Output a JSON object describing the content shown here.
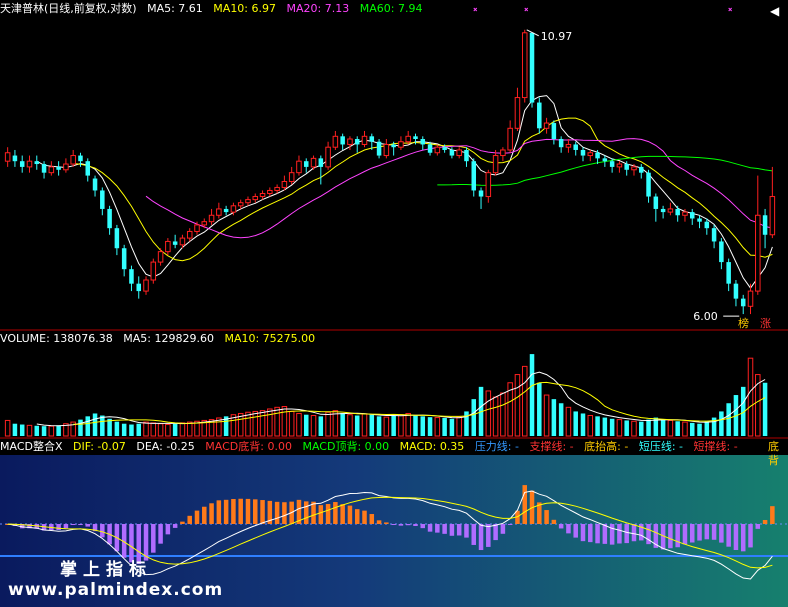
{
  "title": "天津普林(日线,前复权,对数)",
  "price_header": [
    {
      "label": "MA5: 7.61",
      "color": "#ffffff"
    },
    {
      "label": "MA10: 6.97",
      "color": "#ffff00"
    },
    {
      "label": "MA20: 7.13",
      "color": "#ff44ff"
    },
    {
      "label": "MA60: 7.94",
      "color": "#00ff00"
    }
  ],
  "volume_header": [
    {
      "label": "VOLUME: 138076.38",
      "color": "#ffffff"
    },
    {
      "label": "MA5: 129829.60",
      "color": "#ffffff"
    },
    {
      "label": "MA10: 75275.00",
      "color": "#ffff00"
    }
  ],
  "macd_header": [
    {
      "label": "MACD整合X",
      "color": "#ffffff"
    },
    {
      "label": "DIF: -0.07",
      "color": "#ffff00"
    },
    {
      "label": "DEA: -0.25",
      "color": "#ffffff"
    },
    {
      "label": "MACD底背: 0.00",
      "color": "#ff3333"
    },
    {
      "label": "MACD顶背: 0.00",
      "color": "#00ff00"
    },
    {
      "label": "MACD: 0.35",
      "color": "#ffff00"
    },
    {
      "label": "压力线: -",
      "color": "#3399ff"
    },
    {
      "label": "支撑线: -",
      "color": "#ff3333"
    },
    {
      "label": "底抬高: -",
      "color": "#ffcc00"
    },
    {
      "label": "短压线: -",
      "color": "#33ffff"
    },
    {
      "label": "短撑线: -",
      "color": "#ff3333"
    }
  ],
  "macd_right_label": "底背",
  "badges": {
    "bang": "榜",
    "zhang": "涨"
  },
  "watermark": {
    "line1": "掌上指标",
    "line2": "www.palmindex.com"
  },
  "colors": {
    "up": "#ff2020",
    "down": "#33ffff",
    "ma5": "#ffffff",
    "ma10": "#ffff00",
    "ma20": "#ff44ff",
    "ma60": "#00ff00",
    "divider": "#b00000"
  },
  "chart_data": {
    "type": "candlestick",
    "scale": "log",
    "ylim": [
      5.9,
      11.2
    ],
    "annotations": {
      "high": "10.97",
      "low": "6.00"
    },
    "candles": [
      [
        8.3,
        8.45,
        8.55,
        8.2
      ],
      [
        8.4,
        8.3,
        8.5,
        8.2
      ],
      [
        8.3,
        8.2,
        8.4,
        8.1
      ],
      [
        8.2,
        8.3,
        8.4,
        8.1
      ],
      [
        8.3,
        8.25,
        8.4,
        8.15
      ],
      [
        8.25,
        8.1,
        8.3,
        8.0
      ],
      [
        8.1,
        8.2,
        8.3,
        8.05
      ],
      [
        8.2,
        8.15,
        8.3,
        8.05
      ],
      [
        8.15,
        8.25,
        8.35,
        8.1
      ],
      [
        8.25,
        8.4,
        8.5,
        8.2
      ],
      [
        8.4,
        8.3,
        8.45,
        8.2
      ],
      [
        8.3,
        8.05,
        8.35,
        7.95
      ],
      [
        8.0,
        7.8,
        8.05,
        7.7
      ],
      [
        7.8,
        7.5,
        7.85,
        7.4
      ],
      [
        7.5,
        7.2,
        7.55,
        7.1
      ],
      [
        7.2,
        6.9,
        7.25,
        6.8
      ],
      [
        6.9,
        6.6,
        6.95,
        6.5
      ],
      [
        6.6,
        6.4,
        6.65,
        6.3
      ],
      [
        6.4,
        6.3,
        6.5,
        6.2
      ],
      [
        6.3,
        6.45,
        6.5,
        6.25
      ],
      [
        6.45,
        6.7,
        6.75,
        6.4
      ],
      [
        6.7,
        6.85,
        6.9,
        6.65
      ],
      [
        6.85,
        7.0,
        7.05,
        6.8
      ],
      [
        7.0,
        6.95,
        7.1,
        6.9
      ],
      [
        6.95,
        7.05,
        7.1,
        6.9
      ],
      [
        7.05,
        7.15,
        7.2,
        7.0
      ],
      [
        7.15,
        7.25,
        7.3,
        7.1
      ],
      [
        7.25,
        7.3,
        7.35,
        7.2
      ],
      [
        7.3,
        7.4,
        7.5,
        7.25
      ],
      [
        7.4,
        7.5,
        7.6,
        7.35
      ],
      [
        7.5,
        7.45,
        7.55,
        7.4
      ],
      [
        7.45,
        7.55,
        7.6,
        7.4
      ],
      [
        7.55,
        7.6,
        7.65,
        7.5
      ],
      [
        7.6,
        7.65,
        7.7,
        7.55
      ],
      [
        7.65,
        7.7,
        7.75,
        7.6
      ],
      [
        7.7,
        7.75,
        7.8,
        7.65
      ],
      [
        7.75,
        7.8,
        7.85,
        7.7
      ],
      [
        7.8,
        7.85,
        7.9,
        7.75
      ],
      [
        7.85,
        7.95,
        8.05,
        7.8
      ],
      [
        7.95,
        8.1,
        8.2,
        7.9
      ],
      [
        8.1,
        8.3,
        8.4,
        8.05
      ],
      [
        8.3,
        8.2,
        8.35,
        8.1
      ],
      [
        8.2,
        8.35,
        8.4,
        8.15
      ],
      [
        8.35,
        8.2,
        8.4,
        7.9
      ],
      [
        8.2,
        8.55,
        8.65,
        8.15
      ],
      [
        8.55,
        8.75,
        8.85,
        8.5
      ],
      [
        8.75,
        8.6,
        8.8,
        8.5
      ],
      [
        8.6,
        8.7,
        8.75,
        8.5
      ],
      [
        8.7,
        8.6,
        8.75,
        8.45
      ],
      [
        8.6,
        8.75,
        8.85,
        8.55
      ],
      [
        8.75,
        8.65,
        8.8,
        8.5
      ],
      [
        8.65,
        8.4,
        8.7,
        8.35
      ],
      [
        8.4,
        8.6,
        8.7,
        8.35
      ],
      [
        8.6,
        8.55,
        8.65,
        8.4
      ],
      [
        8.55,
        8.65,
        8.75,
        8.5
      ],
      [
        8.65,
        8.75,
        8.85,
        8.6
      ],
      [
        8.75,
        8.7,
        8.8,
        8.6
      ],
      [
        8.7,
        8.6,
        8.75,
        8.5
      ],
      [
        8.6,
        8.45,
        8.65,
        8.4
      ],
      [
        8.45,
        8.55,
        8.6,
        8.4
      ],
      [
        8.55,
        8.5,
        8.6,
        8.45
      ],
      [
        8.5,
        8.4,
        8.55,
        8.35
      ],
      [
        8.4,
        8.5,
        8.55,
        8.35
      ],
      [
        8.5,
        8.3,
        8.55,
        8.2
      ],
      [
        8.3,
        7.8,
        8.35,
        7.7
      ],
      [
        7.8,
        7.7,
        7.85,
        7.5
      ],
      [
        7.7,
        8.1,
        8.15,
        7.6
      ],
      [
        8.1,
        8.4,
        8.5,
        8.05
      ],
      [
        8.4,
        8.5,
        8.55,
        8.3
      ],
      [
        8.5,
        8.9,
        9.05,
        8.45
      ],
      [
        8.9,
        9.5,
        9.7,
        8.85
      ],
      [
        9.5,
        10.9,
        10.97,
        9.4
      ],
      [
        10.9,
        9.4,
        10.9,
        9.3
      ],
      [
        9.4,
        8.9,
        9.5,
        8.8
      ],
      [
        8.9,
        9.0,
        9.1,
        8.8
      ],
      [
        9.0,
        8.7,
        9.05,
        8.6
      ],
      [
        8.7,
        8.55,
        8.75,
        8.45
      ],
      [
        8.55,
        8.6,
        8.7,
        8.45
      ],
      [
        8.6,
        8.5,
        8.65,
        8.4
      ],
      [
        8.5,
        8.4,
        8.55,
        8.3
      ],
      [
        8.4,
        8.45,
        8.5,
        8.3
      ],
      [
        8.45,
        8.35,
        8.5,
        8.25
      ],
      [
        8.35,
        8.3,
        8.4,
        8.2
      ],
      [
        8.3,
        8.2,
        8.35,
        8.1
      ],
      [
        8.2,
        8.25,
        8.3,
        8.1
      ],
      [
        8.25,
        8.15,
        8.3,
        8.05
      ],
      [
        8.15,
        8.2,
        8.25,
        8.05
      ],
      [
        8.2,
        8.1,
        8.25,
        8.0
      ],
      [
        8.1,
        7.7,
        8.15,
        7.6
      ],
      [
        7.7,
        7.5,
        7.75,
        7.3
      ],
      [
        7.5,
        7.45,
        7.55,
        7.35
      ],
      [
        7.45,
        7.5,
        7.6,
        7.4
      ],
      [
        7.5,
        7.4,
        7.55,
        7.3
      ],
      [
        7.4,
        7.45,
        7.5,
        7.3
      ],
      [
        7.45,
        7.35,
        7.5,
        7.25
      ],
      [
        7.35,
        7.3,
        7.4,
        7.2
      ],
      [
        7.3,
        7.2,
        7.35,
        7.1
      ],
      [
        7.2,
        7.0,
        7.25,
        6.9
      ],
      [
        7.0,
        6.7,
        7.05,
        6.6
      ],
      [
        6.7,
        6.4,
        6.75,
        6.3
      ],
      [
        6.4,
        6.2,
        6.45,
        6.1
      ],
      [
        6.2,
        6.1,
        6.25,
        6.0
      ],
      [
        6.1,
        6.3,
        6.4,
        6.0
      ],
      [
        6.3,
        7.4,
        8.05,
        6.25
      ],
      [
        7.4,
        7.1,
        7.5,
        6.9
      ],
      [
        7.1,
        7.7,
        8.2,
        7.05
      ]
    ],
    "volume": [
      38,
      30,
      28,
      26,
      25,
      24,
      24,
      26,
      30,
      34,
      40,
      48,
      55,
      50,
      42,
      35,
      30,
      28,
      30,
      34,
      32,
      30,
      28,
      30,
      32,
      34,
      36,
      38,
      40,
      44,
      48,
      52,
      55,
      58,
      60,
      62,
      66,
      70,
      72,
      60,
      55,
      52,
      50,
      48,
      58,
      62,
      56,
      52,
      50,
      54,
      52,
      48,
      46,
      50,
      52,
      55,
      50,
      48,
      46,
      45,
      44,
      42,
      46,
      60,
      90,
      120,
      110,
      95,
      105,
      130,
      150,
      170,
      200,
      130,
      100,
      90,
      80,
      70,
      60,
      55,
      50,
      48,
      45,
      42,
      40,
      38,
      36,
      35,
      40,
      45,
      40,
      38,
      36,
      34,
      32,
      30,
      35,
      45,
      60,
      80,
      100,
      120,
      190,
      150,
      130
    ],
    "vol_ylim": [
      0,
      210
    ]
  }
}
